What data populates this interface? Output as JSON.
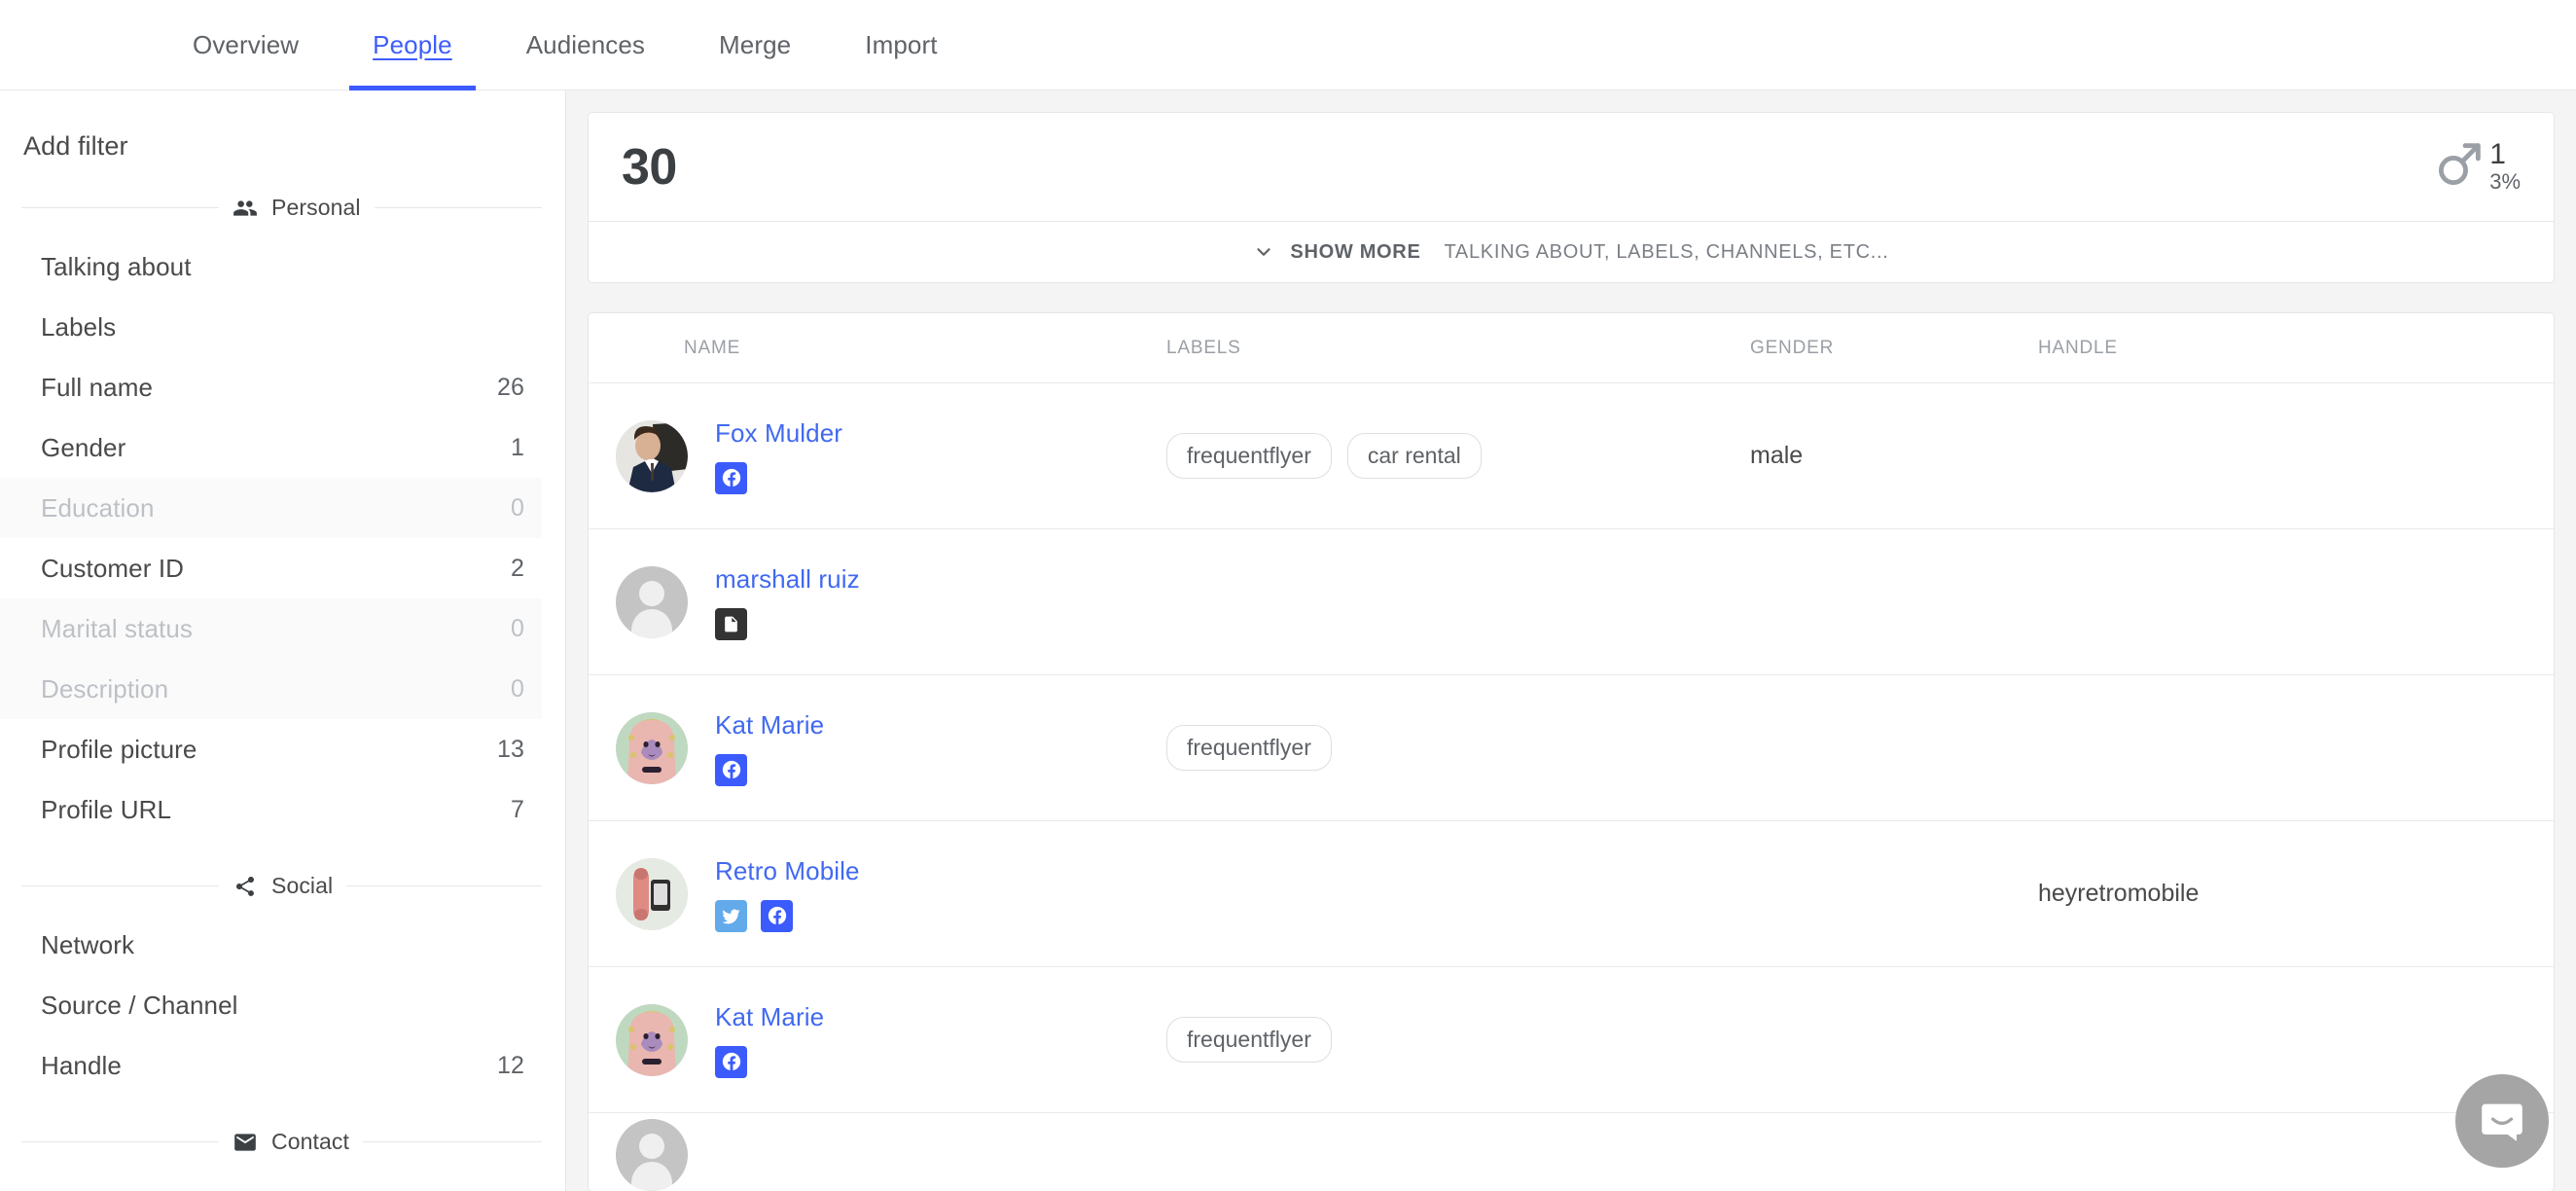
{
  "nav": {
    "tabs": [
      {
        "label": "Overview",
        "active": false
      },
      {
        "label": "People",
        "active": true
      },
      {
        "label": "Audiences",
        "active": false
      },
      {
        "label": "Merge",
        "active": false
      },
      {
        "label": "Import",
        "active": false
      }
    ]
  },
  "sidebar": {
    "title": "Add filter",
    "groups": [
      {
        "name": "Personal",
        "icon": "people-icon",
        "items": [
          {
            "label": "Talking about",
            "count": "",
            "disabled": false
          },
          {
            "label": "Labels",
            "count": "",
            "disabled": false
          },
          {
            "label": "Full name",
            "count": "26",
            "disabled": false
          },
          {
            "label": "Gender",
            "count": "1",
            "disabled": false
          },
          {
            "label": "Education",
            "count": "0",
            "disabled": true
          },
          {
            "label": "Customer ID",
            "count": "2",
            "disabled": false
          },
          {
            "label": "Marital status",
            "count": "0",
            "disabled": true
          },
          {
            "label": "Description",
            "count": "0",
            "disabled": true
          },
          {
            "label": "Profile picture",
            "count": "13",
            "disabled": false
          },
          {
            "label": "Profile URL",
            "count": "7",
            "disabled": false
          }
        ]
      },
      {
        "name": "Social",
        "icon": "share-icon",
        "items": [
          {
            "label": "Network",
            "count": "",
            "disabled": false
          },
          {
            "label": "Source / Channel",
            "count": "",
            "disabled": false
          },
          {
            "label": "Handle",
            "count": "12",
            "disabled": false
          }
        ]
      },
      {
        "name": "Contact",
        "icon": "mail-icon",
        "items": []
      }
    ]
  },
  "stats": {
    "total": "30",
    "gender": {
      "icon": "male-icon",
      "value": "1",
      "percent": "3%"
    }
  },
  "show_more": {
    "icon": "chevron-down-icon",
    "label": "SHOW MORE",
    "subtext": "TALKING ABOUT, LABELS, CHANNELS, ETC..."
  },
  "table": {
    "columns": [
      "NAME",
      "LABELS",
      "GENDER",
      "HANDLE"
    ],
    "rows": [
      {
        "name": "Fox Mulder",
        "avatar": "photo-man-suit",
        "channels": [
          "facebook"
        ],
        "labels": [
          "frequentflyer",
          "car rental"
        ],
        "gender": "male",
        "handle": ""
      },
      {
        "name": "marshall ruiz",
        "avatar": "placeholder-person",
        "channels": [
          "note"
        ],
        "labels": [],
        "gender": "",
        "handle": ""
      },
      {
        "name": "Kat Marie",
        "avatar": "illustration-woman-pink",
        "channels": [
          "facebook"
        ],
        "labels": [
          "frequentflyer"
        ],
        "gender": "",
        "handle": ""
      },
      {
        "name": "Retro Mobile",
        "avatar": "photo-retro-phone",
        "channels": [
          "twitter",
          "facebook"
        ],
        "labels": [],
        "gender": "",
        "handle": "heyretromobile"
      },
      {
        "name": "Kat Marie",
        "avatar": "illustration-woman-pink",
        "channels": [
          "facebook"
        ],
        "labels": [
          "frequentflyer"
        ],
        "gender": "",
        "handle": ""
      }
    ]
  },
  "chat": {
    "icon": "chat-bubble-icon"
  },
  "colors": {
    "accent": "#3b5bfd",
    "link": "#4169f0",
    "facebook": "#3b5bfd",
    "twitter": "#62aaea",
    "note": "#333333",
    "muted": "#9aa0a6",
    "page_bg": "#f4f4f5"
  }
}
